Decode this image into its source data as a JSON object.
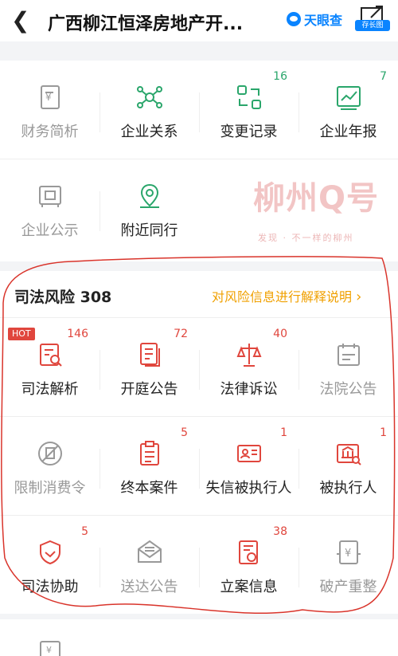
{
  "header": {
    "title": "广西柳江恒泽房地产开...",
    "brand": "天眼查",
    "share_label": "存长图"
  },
  "row1": [
    {
      "label": "财务简析",
      "count": ""
    },
    {
      "label": "企业关系",
      "count": ""
    },
    {
      "label": "变更记录",
      "count": "16"
    },
    {
      "label": "企业年报",
      "count": "7"
    }
  ],
  "row2": [
    {
      "label": "企业公示"
    },
    {
      "label": "附近同行"
    }
  ],
  "watermark": {
    "main": "柳州Q号",
    "sub": "发现 · 不一样的柳州"
  },
  "risk": {
    "title": "司法风险 308",
    "link": "对风险信息进行解释说明",
    "hot": "HOT",
    "row1": [
      {
        "label": "司法解析",
        "count": "146"
      },
      {
        "label": "开庭公告",
        "count": "72"
      },
      {
        "label": "法律诉讼",
        "count": "40"
      },
      {
        "label": "法院公告",
        "count": ""
      }
    ],
    "row2": [
      {
        "label": "限制消费令",
        "count": ""
      },
      {
        "label": "终本案件",
        "count": "5"
      },
      {
        "label": "失信被执行人",
        "count": "1"
      },
      {
        "label": "被执行人",
        "count": "1"
      }
    ],
    "row3": [
      {
        "label": "司法协助",
        "count": "5"
      },
      {
        "label": "送达公告",
        "count": ""
      },
      {
        "label": "立案信息",
        "count": "38"
      },
      {
        "label": "破产重整",
        "count": ""
      }
    ]
  },
  "colors": {
    "green": "#2aa66b",
    "red": "#e0463d",
    "orange": "#f0a000",
    "blue": "#0a84ff"
  }
}
